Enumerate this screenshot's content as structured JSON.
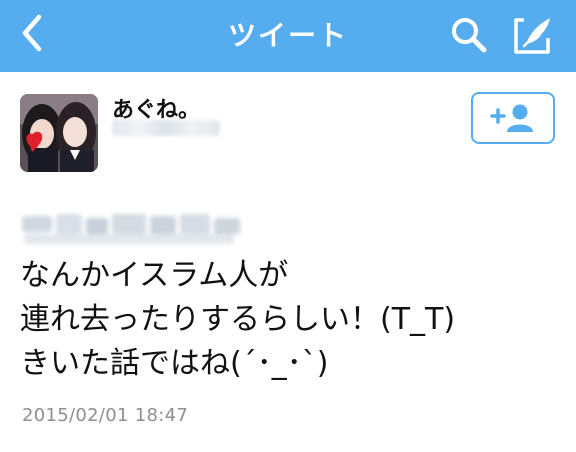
{
  "navbar": {
    "title": "ツイート",
    "back_icon": "chevron-left-icon",
    "search_icon": "search-icon",
    "compose_icon": "compose-icon",
    "background_color": "#55acee"
  },
  "author": {
    "display_name": "あぐね。",
    "avatar_icon": "avatar-photo",
    "follow_icon": "add-user-icon"
  },
  "tweet": {
    "lines": [
      "なんかイスラム人が",
      "連れ去ったりするらしい！(T_T)",
      "きいた話ではね(´･_･`)"
    ],
    "timestamp": "2015/02/01 18:47"
  }
}
